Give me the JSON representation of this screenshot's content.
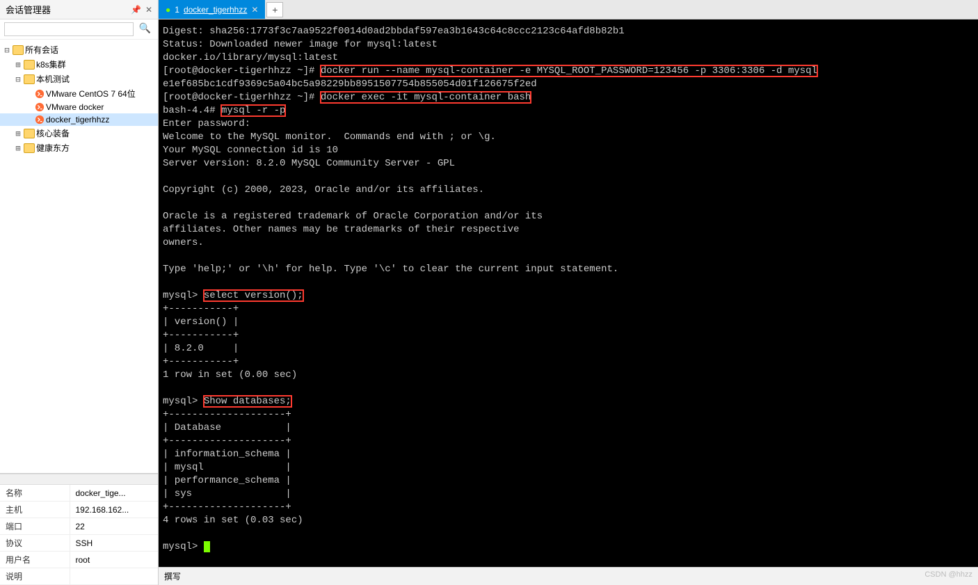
{
  "sidebar": {
    "title": "会话管理器",
    "search_placeholder": "",
    "tree": {
      "root": "所有会话",
      "items": [
        {
          "label": "k8s集群",
          "type": "folder"
        },
        {
          "label": "本机测试",
          "type": "folder"
        },
        {
          "label": "VMware CentOS 7 64位",
          "type": "terminal",
          "parent": "本机测试"
        },
        {
          "label": "VMware docker",
          "type": "terminal",
          "parent": "本机测试"
        },
        {
          "label": "docker_tigerhhzz",
          "type": "terminal",
          "parent": "本机测试",
          "selected": true
        },
        {
          "label": "核心装备",
          "type": "folder"
        },
        {
          "label": "健康东方",
          "type": "folder"
        }
      ]
    }
  },
  "props": [
    {
      "key": "名称",
      "value": "docker_tige..."
    },
    {
      "key": "主机",
      "value": "192.168.162..."
    },
    {
      "key": "端口",
      "value": "22"
    },
    {
      "key": "协议",
      "value": "SSH"
    },
    {
      "key": "用户名",
      "value": "root"
    },
    {
      "key": "说明",
      "value": ""
    }
  ],
  "tab": {
    "index": "1",
    "title": "docker_tigerhhzz"
  },
  "terminal": {
    "lines": {
      "l1": "Digest: sha256:1773f3c7aa9522f0014d0ad2bbdaf597ea3b1643c64c8ccc2123c64afd8b82b1",
      "l2": "Status: Downloaded newer image for mysql:latest",
      "l3": "docker.io/library/mysql:latest",
      "l4_prompt": "[root@docker-tigerhhzz ~]# ",
      "l4_cmd": "docker run --name mysql-container -e MYSQL_ROOT_PASSWORD=123456 -p 3306:3306 -d mysql",
      "l5": "e1ef685bc1cdf9369c5a04bc5a98229bb8951507754b855054d01f126675f2ed",
      "l6_prompt": "[root@docker-tigerhhzz ~]# ",
      "l6_cmd": "docker exec -it mysql-container bash",
      "l7_prompt": "bash-4.4# ",
      "l7_cmd": "mysql -r -p",
      "l8": "Enter password:",
      "l9": "Welcome to the MySQL monitor.  Commands end with ; or \\g.",
      "l10": "Your MySQL connection id is 10",
      "l11": "Server version: 8.2.0 MySQL Community Server - GPL",
      "l12": "",
      "l13": "Copyright (c) 2000, 2023, Oracle and/or its affiliates.",
      "l14": "",
      "l15": "Oracle is a registered trademark of Oracle Corporation and/or its",
      "l16": "affiliates. Other names may be trademarks of their respective",
      "l17": "owners.",
      "l18": "",
      "l19": "Type 'help;' or '\\h' for help. Type '\\c' to clear the current input statement.",
      "l20": "",
      "l21_prompt": "mysql> ",
      "l21_cmd": "select version();",
      "l22": "+-----------+",
      "l23": "| version() |",
      "l24": "+-----------+",
      "l25": "| 8.2.0     |",
      "l26": "+-----------+",
      "l27": "1 row in set (0.00 sec)",
      "l28": "",
      "l29_prompt": "mysql> ",
      "l29_cmd": "Show databases;",
      "l30": "+--------------------+",
      "l31": "| Database           |",
      "l32": "+--------------------+",
      "l33": "| information_schema |",
      "l34": "| mysql              |",
      "l35": "| performance_schema |",
      "l36": "| sys                |",
      "l37": "+--------------------+",
      "l38": "4 rows in set (0.03 sec)",
      "l39": "",
      "l40_prompt": "mysql> "
    }
  },
  "status": {
    "left": "撰写",
    "watermark": "CSDN @hhzz"
  }
}
